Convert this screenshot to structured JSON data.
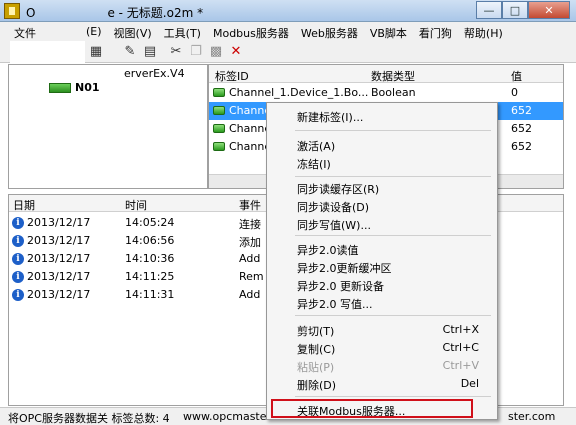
{
  "window": {
    "title": "O      e - 无标题.o2m *"
  },
  "menubar": [
    {
      "label": "文件"
    },
    {
      "label": "(E)"
    },
    {
      "label": "视图(V)"
    },
    {
      "label": "工具(T)"
    },
    {
      "label": "Modbus服务器"
    },
    {
      "label": "Web服务器"
    },
    {
      "label": "VB脚本"
    },
    {
      "label": "看门狗"
    },
    {
      "label": "帮助(H)"
    }
  ],
  "tree": {
    "root_label": "erverEx.V4",
    "node_label": "N01"
  },
  "tag_table": {
    "columns": [
      "标签ID",
      "数据类型",
      "值"
    ],
    "rows": [
      {
        "id": "Channel_1.Device_1.Bo...",
        "type": "Boolean",
        "value": "0"
      },
      {
        "id": "Channe",
        "type": "",
        "value": "652"
      },
      {
        "id": "Channe",
        "type": "",
        "value": "652"
      },
      {
        "id": "Channe",
        "type": "",
        "value": "652"
      }
    ]
  },
  "log": {
    "columns": [
      "日期",
      "时间",
      "事件"
    ],
    "rows": [
      {
        "date": "2013/12/17",
        "time": "14:05:24",
        "event": "连接"
      },
      {
        "date": "2013/12/17",
        "time": "14:06:56",
        "event": "添加"
      },
      {
        "date": "2013/12/17",
        "time": "14:10:36",
        "event": "Add"
      },
      {
        "date": "2013/12/17",
        "time": "14:11:25",
        "event": "Rem"
      },
      {
        "date": "2013/12/17",
        "time": "14:11:31",
        "event": "Add"
      }
    ]
  },
  "statusbar": {
    "left": "将OPC服务器数据关 标签总数: 4",
    "url": "www.opcmaste",
    "right": "ster.com"
  },
  "context_menu": {
    "items": [
      {
        "label": "新建标签(I)..."
      },
      {
        "label": "激活(A)"
      },
      {
        "label": "冻结(I)"
      },
      {
        "label": "同步读缓存区(R)"
      },
      {
        "label": "同步读设备(D)"
      },
      {
        "label": "同步写值(W)..."
      },
      {
        "label": "异步2.0读值"
      },
      {
        "label": "异步2.0更新缓冲区"
      },
      {
        "label": "异步2.0 更新设备"
      },
      {
        "label": "异步2.0 写值..."
      },
      {
        "label": "剪切(T)",
        "key": "Ctrl+X"
      },
      {
        "label": "复制(C)",
        "key": "Ctrl+C"
      },
      {
        "label": "粘贴(P)",
        "key": "Ctrl+V"
      },
      {
        "label": "删除(D)",
        "key": "Del"
      },
      {
        "label": "关联Modbus服务器..."
      }
    ]
  },
  "colors": {
    "selection": "#3399ff",
    "highlight_border": "#d0101a",
    "tag_icon": "#2a9a1e",
    "info_icon": "#1d5fc8"
  }
}
